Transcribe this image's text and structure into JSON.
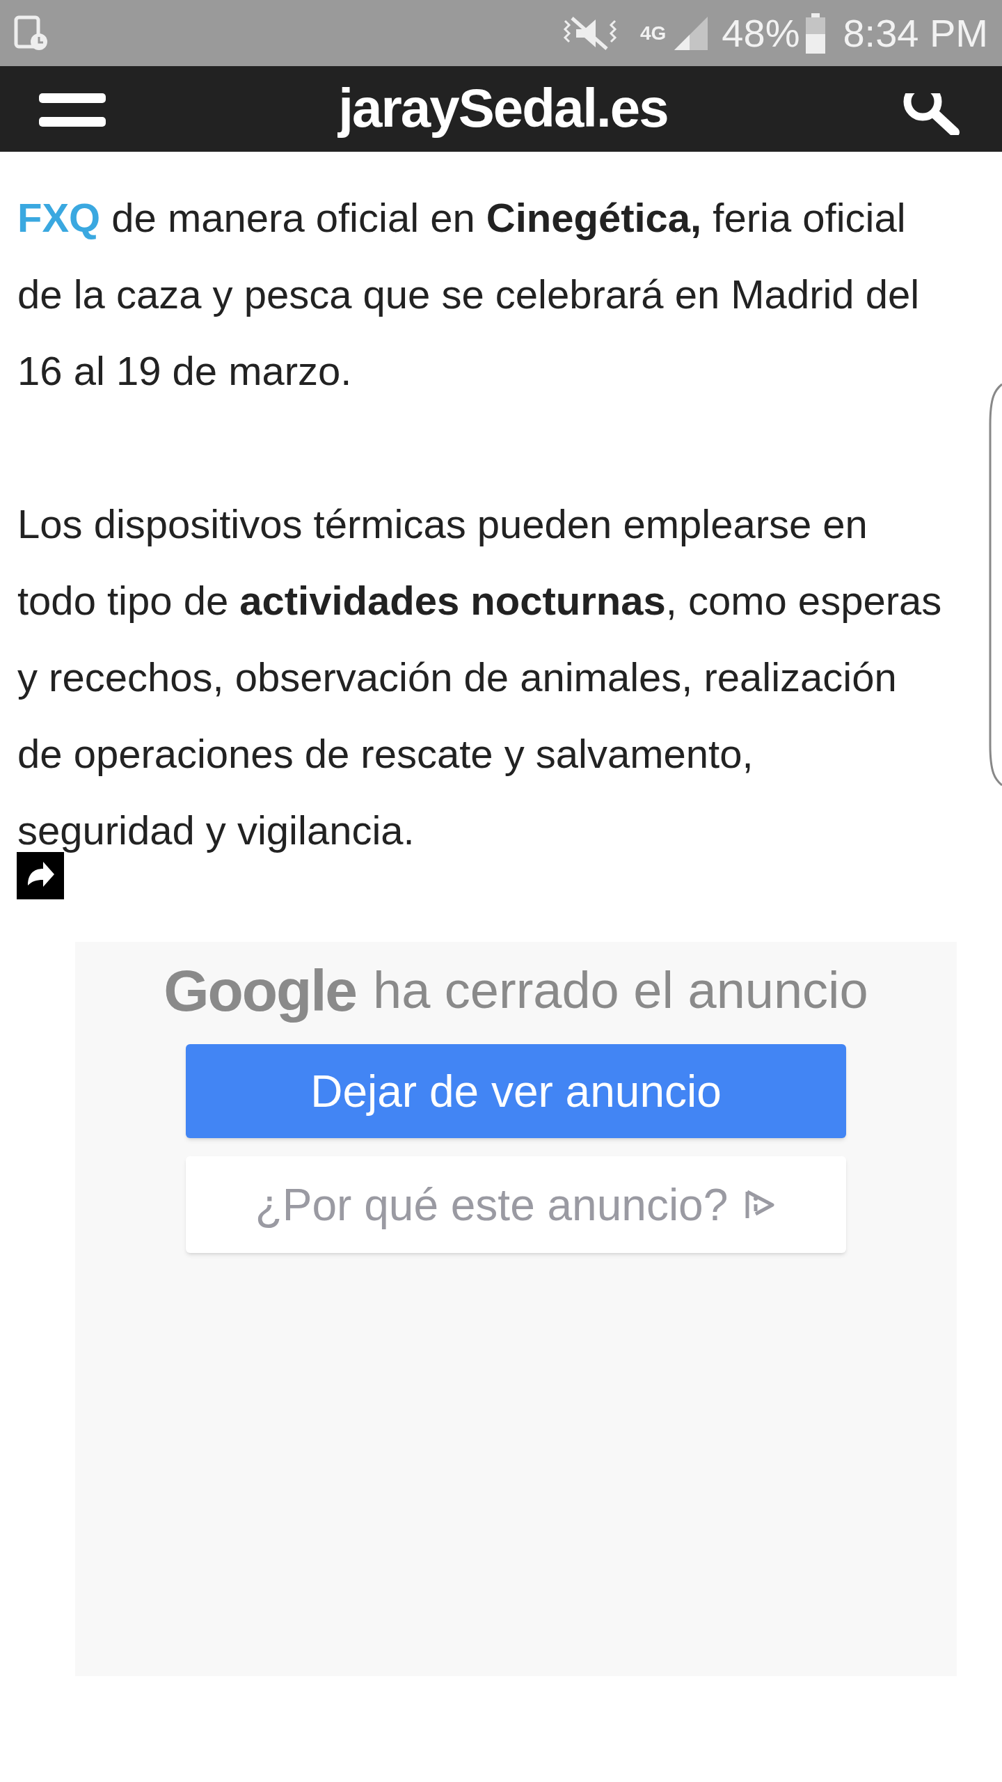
{
  "status_bar": {
    "battery": "48%",
    "network": "4G",
    "time": "8:34 PM"
  },
  "header": {
    "logo": "jaraySedal.es"
  },
  "article": {
    "paragraphs": [
      {
        "link": "FXQ",
        "lines": [
          " de manera oficial en **Cinegética,** feria oficial",
          "de la caza y pesca que se celebrará en Madrid del",
          "16 al 19 de marzo."
        ]
      },
      {
        "lines": [
          "Los dispositivos térmicas pueden emplearse en",
          "todo tipo de **actividades nocturnas**, como esperas",
          "y recechos, observación de animales, realización",
          "de operaciones de rescate y salvamento,",
          "seguridad y vigilancia."
        ]
      }
    ]
  },
  "ad": {
    "brand": "Google",
    "message": "ha cerrado el anuncio",
    "buttons": [
      {
        "label": "Dejar de ver anuncio",
        "kind": "primary"
      },
      {
        "label": "¿Por qué este anuncio?",
        "kind": "secondary"
      }
    ]
  }
}
